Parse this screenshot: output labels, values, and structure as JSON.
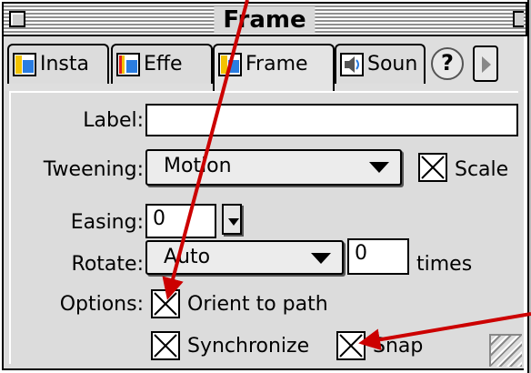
{
  "window": {
    "title": "Frame"
  },
  "tabs": [
    {
      "label": "Insta",
      "icon": "instance-icon"
    },
    {
      "label": "Effe",
      "icon": "effect-icon"
    },
    {
      "label": "Frame",
      "icon": "frame-icon",
      "active": true
    },
    {
      "label": "Soun",
      "icon": "sound-icon"
    }
  ],
  "help_label": "?",
  "form": {
    "label_label": "Label:",
    "label_value": "",
    "tweening_label": "Tweening:",
    "tweening_value": "Motion",
    "scale_label": "Scale",
    "scale_checked": true,
    "easing_label": "Easing:",
    "easing_value": "0",
    "rotate_label": "Rotate:",
    "rotate_value": "Auto",
    "times_value": "0",
    "times_label": "times",
    "options_label": "Options:",
    "orient_label": "Orient to path",
    "orient_checked": true,
    "synchronize_label": "Synchronize",
    "synchronize_checked": true,
    "snap_label": "Snap",
    "snap_checked": true
  },
  "annotation": {
    "arrow_color": "#cc0000"
  }
}
